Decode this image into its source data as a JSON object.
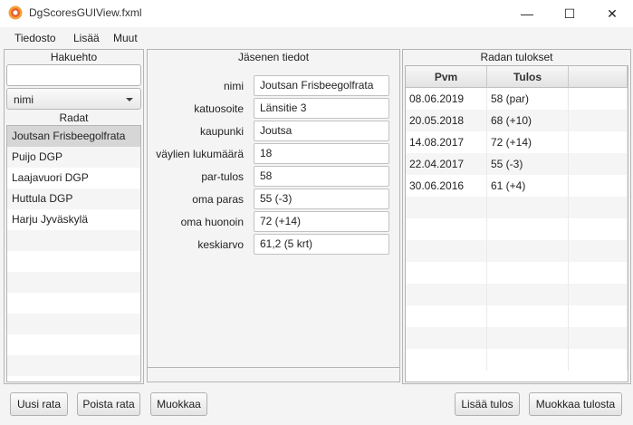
{
  "window": {
    "title": "DgScoresGUIView.fxml",
    "minimize_glyph": "—",
    "maximize_glyph": "☐",
    "close_glyph": "✕"
  },
  "menu": {
    "items": [
      "Tiedosto",
      "Lisää",
      "Muut"
    ]
  },
  "left_panel": {
    "title": "Hakuehto",
    "search_value": "",
    "combo_value": "nimi",
    "list_title": "Radat",
    "items": [
      "Joutsan Frisbeegolfrata",
      "Puijo DGP",
      "Laajavuori DGP",
      "Huttula DGP",
      "Harju Jyväskylä"
    ],
    "selected_index": 0
  },
  "center_panel": {
    "title": "Jäsenen tiedot",
    "fields": [
      {
        "label": "nimi",
        "value": "Joutsan Frisbeegolfrata"
      },
      {
        "label": "katuosoite",
        "value": "Länsitie 3"
      },
      {
        "label": "kaupunki",
        "value": "Joutsa"
      },
      {
        "label": "väylien lukumäärä",
        "value": "18"
      },
      {
        "label": "par-tulos",
        "value": "58"
      },
      {
        "label": "oma paras",
        "value": "55 (-3)"
      },
      {
        "label": "oma huonoin",
        "value": "72 (+14)"
      },
      {
        "label": "keskiarvo",
        "value": "61,2 (5 krt)"
      }
    ]
  },
  "right_panel": {
    "title": "Radan tulokset",
    "columns": [
      "Pvm",
      "Tulos",
      ""
    ],
    "rows": [
      [
        "08.06.2019",
        "58 (par)"
      ],
      [
        "20.05.2018",
        "68 (+10)"
      ],
      [
        "14.08.2017",
        "72 (+14)"
      ],
      [
        "22.04.2017",
        "55 (-3)"
      ],
      [
        "30.06.2016",
        "61 (+4)"
      ]
    ]
  },
  "buttons": {
    "new_course": "Uusi rata",
    "delete_course": "Poista rata",
    "edit": "Muokkaa",
    "add_result": "Lisää tulos",
    "edit_result": "Muokkaa tulosta"
  },
  "colors": {
    "selected_row": "#d6d6d6",
    "stripe_row": "#f5f5f5",
    "app_icon": "#f39c3a"
  }
}
